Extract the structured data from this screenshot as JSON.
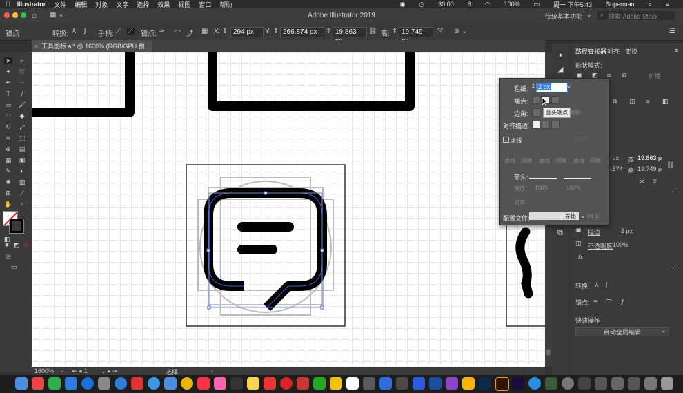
{
  "menubar": {
    "apple": "",
    "app_name": "Illustrator",
    "items": [
      "文件",
      "编辑",
      "对象",
      "文字",
      "选择",
      "效果",
      "视图",
      "窗口",
      "帮助"
    ],
    "clock_time": "30:00",
    "badge": "6",
    "battery": "100%",
    "datetime": "周一 下午5:43",
    "user": "Superman"
  },
  "titlebar": {
    "title": "Adobe Illustrator 2019",
    "workspace": "传统基本功能",
    "search_placeholder": "搜索 Adobe Stock"
  },
  "control_bar": {
    "mode_label": "锚点",
    "convert_label": "转换:",
    "handles_label": "手柄:",
    "anchor_label": "锚点:",
    "x_label": "X:",
    "x_value": "294 px",
    "y_label": "Y:",
    "y_value": "266.874 px",
    "w_label": "宽:",
    "w_value": "19.863 px",
    "h_label": "高:",
    "h_value": "19.749 px"
  },
  "document_tab": {
    "name": "工具图标.ai* @ 1600% (RGB/GPU 预览)"
  },
  "status_bar": {
    "zoom": "1600%",
    "artboard": "1",
    "tool": "选择"
  },
  "stroke_panel": {
    "weight_label": "粗细:",
    "weight_value": "2 px",
    "cap_label": "端点:",
    "tooltip": "圆头端点",
    "corner_label": "边角:",
    "limit_label": "限制:",
    "align_label": "对齐描边:",
    "dashed_label": "虚线",
    "dash_labels": [
      "虚线",
      "间隙",
      "虚线",
      "间隙",
      "虚线",
      "间隙"
    ],
    "arrow_label": "箭头:",
    "scale_label": "缩放:",
    "scale_values": [
      "100%",
      "100%"
    ],
    "align_arrow_label": "对齐:",
    "profile_label": "配置文件:",
    "profile_value": "等比"
  },
  "right_panel": {
    "tabs": [
      "路径查找器",
      "对齐",
      "变换"
    ],
    "shape_mode_label": "形状模式:",
    "expand_label": "扩展",
    "pathfinder_label": "路径查找器:",
    "w_label": "宽:",
    "w_value": "19.863 p",
    "h_label": "高:",
    "h_value": "19.749 p",
    "x_partial": "4 px",
    "y_partial": "6.874",
    "stroke_label": "描边",
    "stroke_value": "2 px",
    "opacity_label": "不透明度",
    "opacity_value": "100%",
    "fx_label": "fx.",
    "convert_label": "转换:",
    "anchor_label": "锚点:",
    "quick_actions_label": "快速操作",
    "global_edit_button": "启动全局编辑"
  },
  "colors": {
    "app_bg": "#323232",
    "panel_bg": "#535353",
    "canvas_bg": "#ffffff",
    "grid": "#e9e9e9",
    "selection": "#3b5bdb",
    "stroke": "#000000",
    "field_highlight": "#3b7de0"
  }
}
